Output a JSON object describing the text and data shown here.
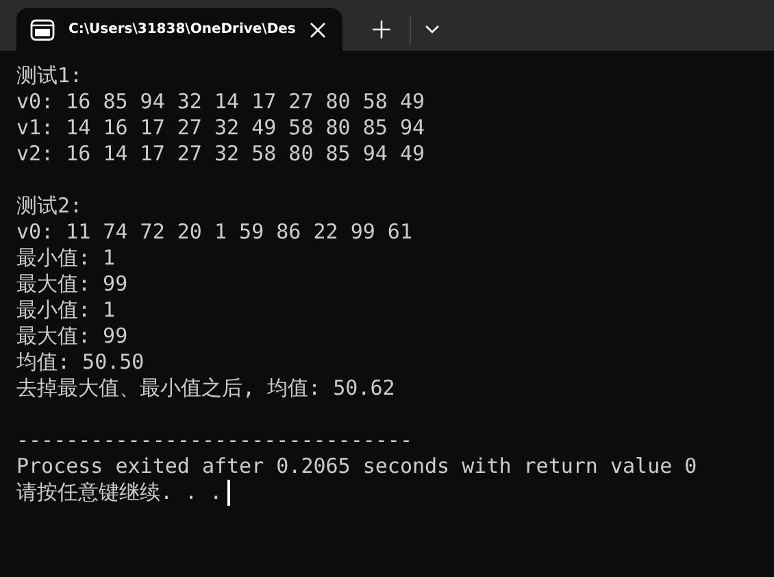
{
  "tab": {
    "title": "C:\\Users\\31838\\OneDrive\\Des",
    "selected": true
  },
  "console": {
    "lines": [
      {
        "kind": "text",
        "text": "测试1:"
      },
      {
        "kind": "text",
        "text": "v0: 16 85 94 32 14 17 27 80 58 49"
      },
      {
        "kind": "text",
        "text": "v1: 14 16 17 27 32 49 58 80 85 94"
      },
      {
        "kind": "text",
        "text": "v2: 16 14 17 27 32 58 80 85 94 49"
      },
      {
        "kind": "blank"
      },
      {
        "kind": "text",
        "text": "测试2:"
      },
      {
        "kind": "text",
        "text": "v0: 11 74 72 20 1 59 86 22 99 61"
      },
      {
        "kind": "text",
        "text": "最小值: 1"
      },
      {
        "kind": "text",
        "text": "最大值: 99"
      },
      {
        "kind": "text",
        "text": "最小值: 1"
      },
      {
        "kind": "text",
        "text": "最大值: 99"
      },
      {
        "kind": "text",
        "text": "均值: 50.50"
      },
      {
        "kind": "text",
        "text": "去掉最大值、最小值之后, 均值: 50.62"
      },
      {
        "kind": "blank"
      },
      {
        "kind": "text",
        "text": "--------------------------------"
      },
      {
        "kind": "text",
        "text": "Process exited after 0.2065 seconds with return value 0"
      },
      {
        "kind": "text",
        "text": "请按任意键继续. . ."
      }
    ],
    "cursor": true
  }
}
